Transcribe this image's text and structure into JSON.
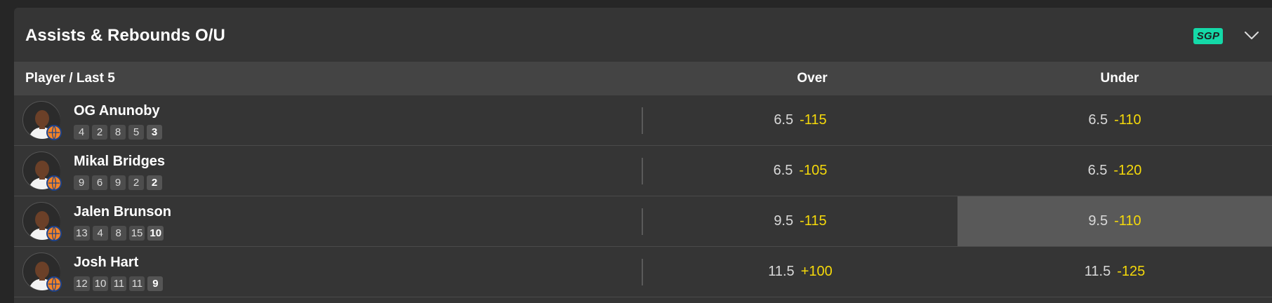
{
  "market": {
    "title": "Assists & Rebounds O/U",
    "badge": "SGP",
    "columns": {
      "player": "Player / Last 5",
      "over": "Over",
      "under": "Under"
    }
  },
  "players": [
    {
      "name": "OG Anunoby",
      "last5": [
        "4",
        "2",
        "8",
        "5",
        "3"
      ],
      "over": {
        "line": "6.5",
        "price": "-115"
      },
      "under": {
        "line": "6.5",
        "price": "-110"
      },
      "selected": ""
    },
    {
      "name": "Mikal Bridges",
      "last5": [
        "9",
        "6",
        "9",
        "2",
        "2"
      ],
      "over": {
        "line": "6.5",
        "price": "-105"
      },
      "under": {
        "line": "6.5",
        "price": "-120"
      },
      "selected": ""
    },
    {
      "name": "Jalen Brunson",
      "last5": [
        "13",
        "4",
        "8",
        "15",
        "10"
      ],
      "over": {
        "line": "9.5",
        "price": "-115"
      },
      "under": {
        "line": "9.5",
        "price": "-110"
      },
      "selected": "under"
    },
    {
      "name": "Josh Hart",
      "last5": [
        "12",
        "10",
        "11",
        "11",
        "9"
      ],
      "over": {
        "line": "11.5",
        "price": "+100"
      },
      "under": {
        "line": "11.5",
        "price": "-125"
      },
      "selected": ""
    }
  ],
  "colors": {
    "accent_badge": "#14d9a8",
    "price": "#f5d90a",
    "team": "#f58426"
  },
  "icons": {
    "collapse": "chevron-down-icon",
    "team_logo": "knicks-logo-icon"
  }
}
